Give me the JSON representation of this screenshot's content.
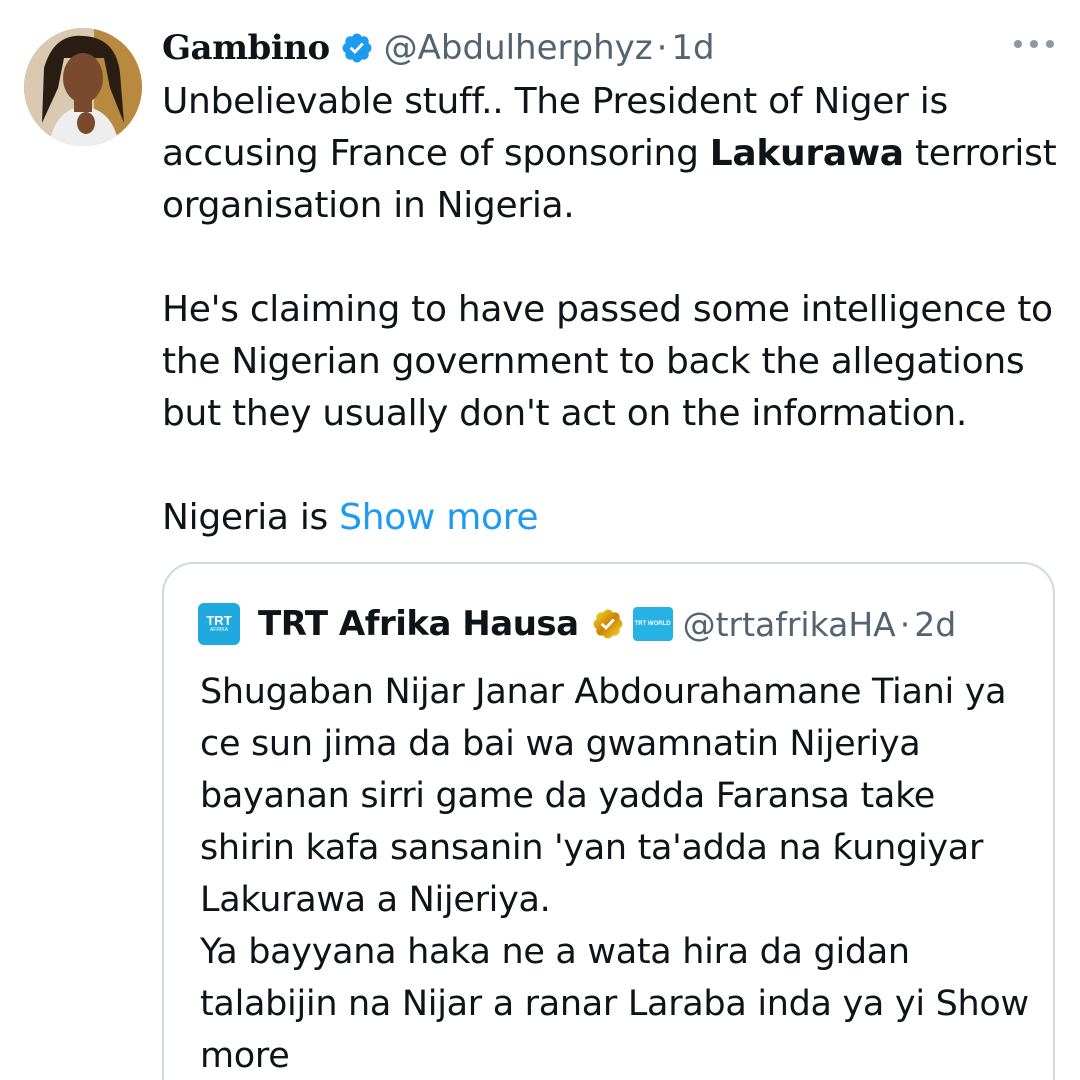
{
  "tweet": {
    "display_name": "Gambino",
    "handle": "@Abdulherphyz",
    "separator": "·",
    "time": "1d",
    "verified_icon": "blue-verified-badge",
    "more_icon": "more-dots-icon",
    "text": {
      "line1_pre": "Unbelievable stuff.. The President of Niger is accusing France of sponsoring ",
      "line1_bold": "Lakurawa",
      "line1_post": " terrorist organisation in Nigeria.",
      "paragraph2": "He's claiming to have passed some intelligence to the Nigerian government to back the allegations but they usually don't act on the information.",
      "paragraph3": "Nigeria is ",
      "show_more": "Show more"
    }
  },
  "quote": {
    "avatar_text": "TRT",
    "avatar_subtext": "AFRIKA",
    "display_name": "TRT Afrika Hausa",
    "verified_icon": "gold-verified-badge",
    "org_badge_text": "TRT WORLD",
    "handle": "@trtafrikaHA",
    "separator": "·",
    "time": "2d",
    "text": {
      "paragraph1": "Shugaban Nijar Janar Abdourahamane Tiani ya ce sun jima da bai wa gwamnatin Nijeriya bayanan sirri game da yadda Faransa take shirin kafa sansanin 'yan ta'adda na ƙungiyar Lakurawa a Nijeriya.",
      "paragraph2": "Ya bayyana haka ne a wata hira da gidan talabijin na Nijar a ranar Laraba inda ya yi ",
      "show_more": "Show more"
    }
  },
  "colors": {
    "text_primary": "#0f1419",
    "text_secondary": "#536471",
    "link": "#1d9bf0",
    "verified_blue": "#1d9bf0",
    "verified_gold": "#e2b719",
    "border": "#cfd9de"
  }
}
